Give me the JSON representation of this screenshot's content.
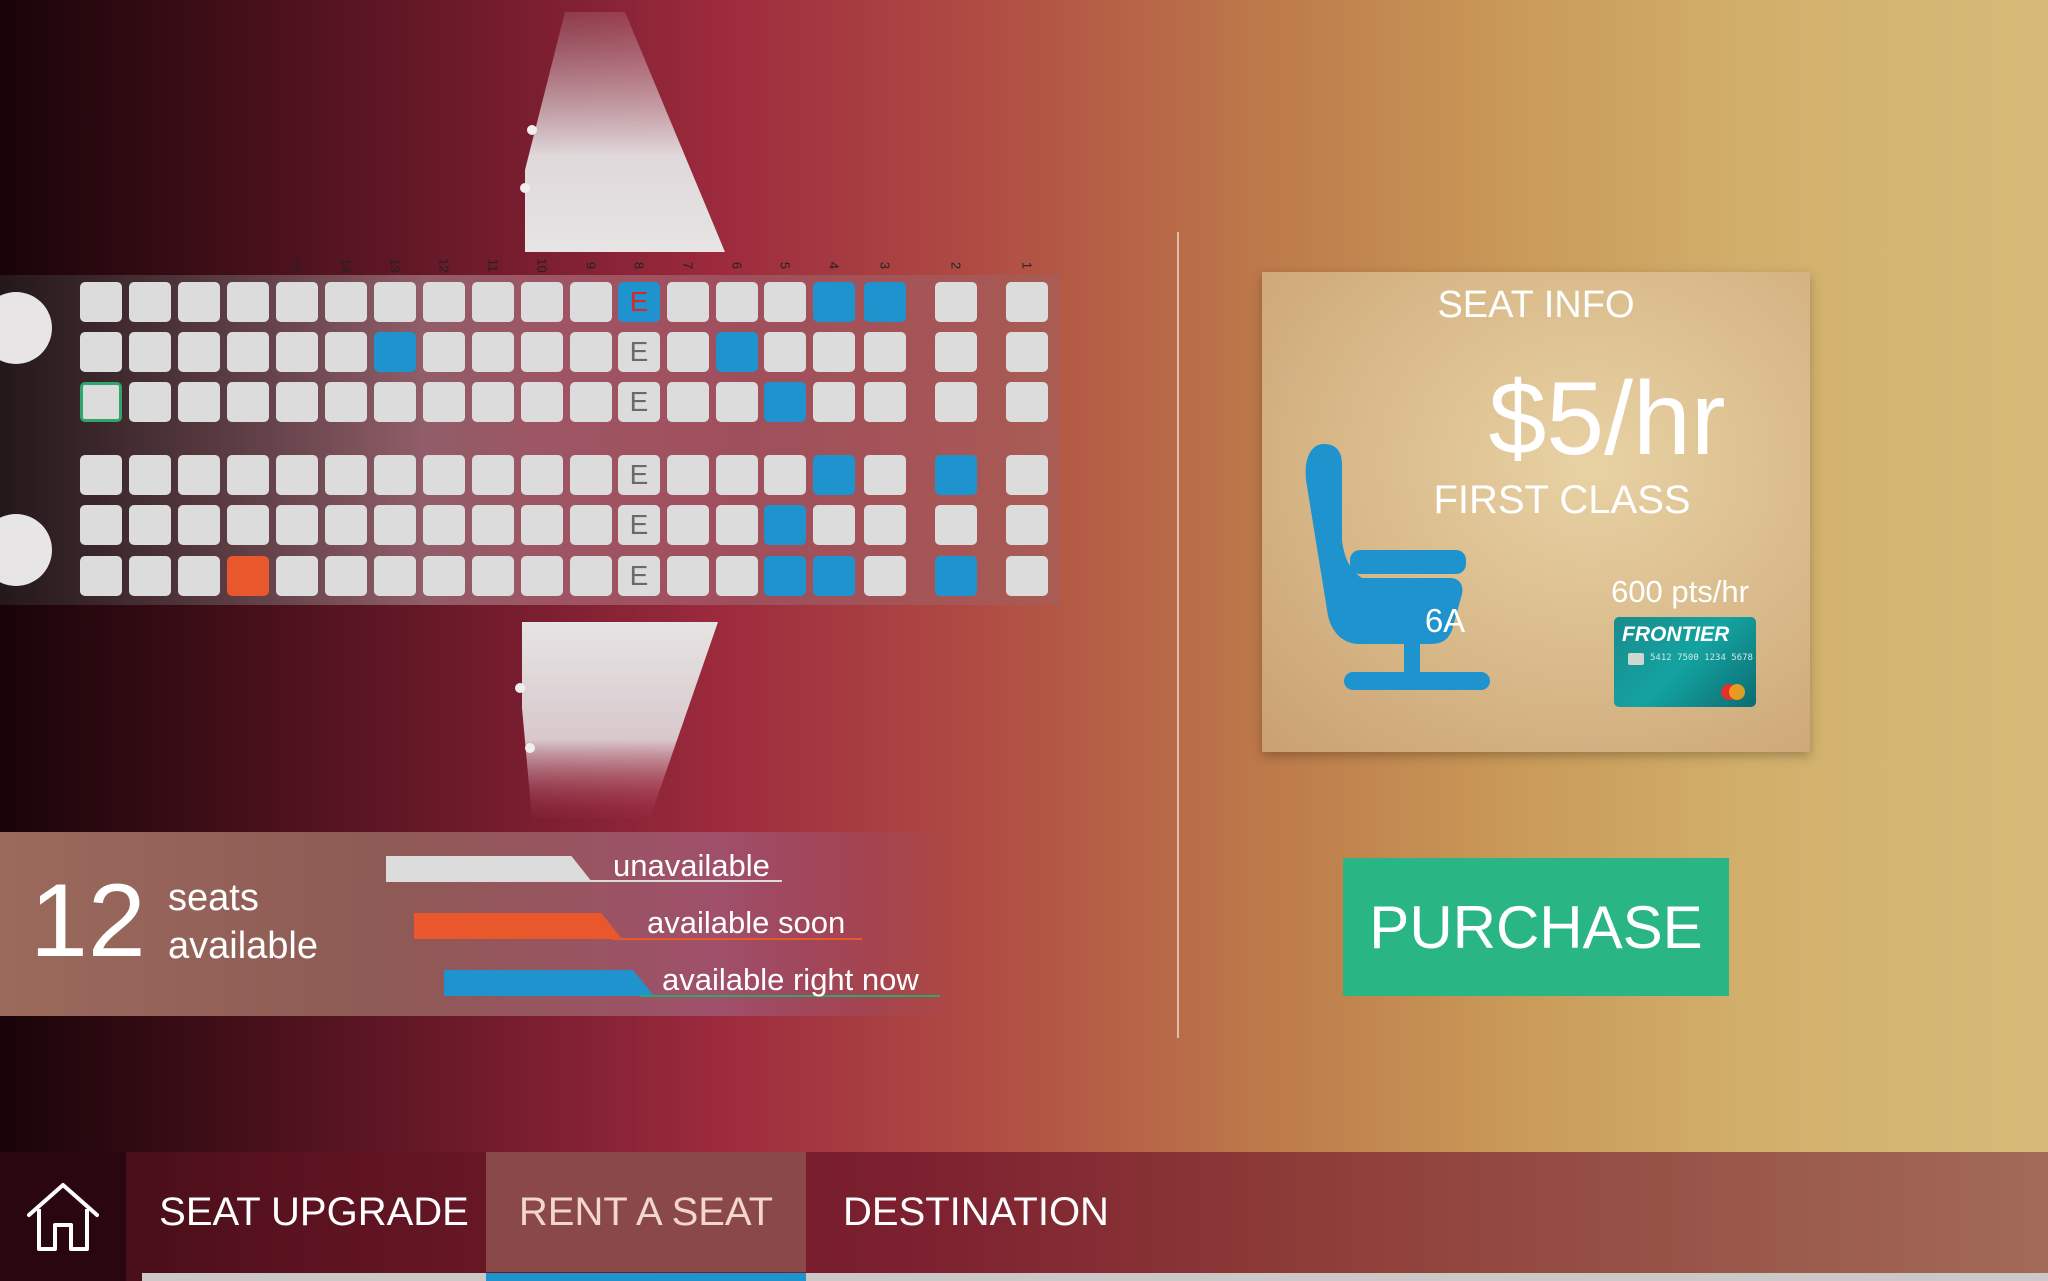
{
  "seat_map": {
    "row_numbers": [
      "15",
      "14",
      "13",
      "12",
      "11",
      "10",
      "9",
      "8",
      "7",
      "6",
      "5",
      "4",
      "3",
      "2",
      "1"
    ],
    "exit_letter": "E",
    "seat_rows": [
      [
        "x",
        "x",
        "x",
        "x",
        "x",
        "x",
        "x",
        "x",
        "x",
        "x",
        "x",
        "exit-active",
        "x",
        "x",
        "x",
        "a",
        "a",
        "x",
        "x"
      ],
      [
        "x",
        "x",
        "x",
        "x",
        "x",
        "x",
        "a",
        "x",
        "x",
        "x",
        "x",
        "exit",
        "x",
        "a",
        "x",
        "x",
        "x",
        "x",
        "x"
      ],
      [
        "o",
        "x",
        "x",
        "x",
        "x",
        "x",
        "x",
        "x",
        "x",
        "x",
        "x",
        "exit",
        "x",
        "x",
        "a",
        "x",
        "x",
        "x",
        "x"
      ],
      [
        "x",
        "x",
        "x",
        "x",
        "x",
        "x",
        "x",
        "x",
        "x",
        "x",
        "x",
        "exit",
        "x",
        "x",
        "x",
        "a",
        "x",
        "a",
        "x"
      ],
      [
        "x",
        "x",
        "x",
        "x",
        "x",
        "x",
        "x",
        "x",
        "x",
        "x",
        "x",
        "exit",
        "x",
        "x",
        "a",
        "x",
        "x",
        "x",
        "x"
      ],
      [
        "x",
        "x",
        "x",
        "s",
        "x",
        "x",
        "x",
        "x",
        "x",
        "x",
        "x",
        "exit",
        "x",
        "x",
        "a",
        "a",
        "x",
        "a",
        "x"
      ]
    ]
  },
  "availability": {
    "count": "12",
    "label_line1": "seats",
    "label_line2": "available"
  },
  "legend": [
    {
      "label": "unavailable",
      "color": "#dcdcdc"
    },
    {
      "label": "available soon",
      "color": "#e8582c"
    },
    {
      "label": "available right now",
      "color": "#1e93cd"
    }
  ],
  "seat_info": {
    "title": "SEAT INFO",
    "price": "$5/hr",
    "class": "FIRST CLASS",
    "seat": "6A",
    "points": "600 pts/hr",
    "card_brand": "FRONTIER",
    "card_number": "5412 7500 1234 5678",
    "chair_icon": "seat-icon",
    "chair_color": "#1e93cd"
  },
  "purchase_label": "PURCHASE",
  "nav": {
    "home_icon": "home-icon",
    "items": [
      {
        "label": "SEAT UPGRADE",
        "active": false
      },
      {
        "label": "RENT A SEAT",
        "active": true
      },
      {
        "label": "DESTINATION",
        "active": false
      }
    ]
  }
}
